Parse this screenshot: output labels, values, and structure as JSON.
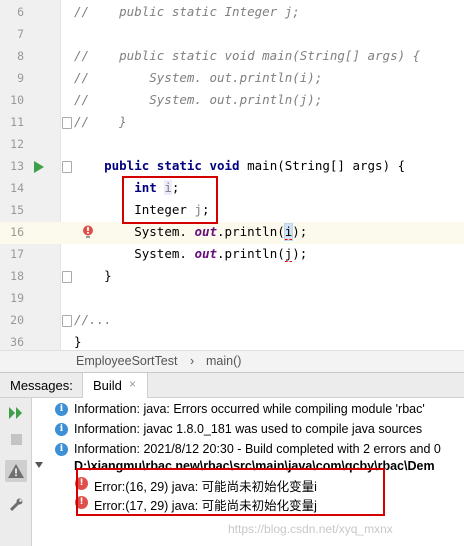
{
  "editor": {
    "lines": [
      {
        "num": "6",
        "code": "//    public static Integer j;"
      },
      {
        "num": "7",
        "code": ""
      },
      {
        "num": "8",
        "code": "//    public static void main(String[] args) {"
      },
      {
        "num": "9",
        "code": "//        System. out.println(i);"
      },
      {
        "num": "10",
        "code": "//        System. out.println(j);"
      },
      {
        "num": "11",
        "code": "//    }"
      },
      {
        "num": "12",
        "code": ""
      },
      {
        "num": "13",
        "code": "    public static void main(String[] args) {"
      },
      {
        "num": "14",
        "code": "        int i;"
      },
      {
        "num": "15",
        "code": "        Integer j;"
      },
      {
        "num": "16",
        "code": "        System. out.println(i);"
      },
      {
        "num": "17",
        "code": "        System. out.println(j);"
      },
      {
        "num": "18",
        "code": "    }"
      },
      {
        "num": "19",
        "code": ""
      },
      {
        "num": "20",
        "code": "//..."
      },
      {
        "num": "36",
        "code": "}"
      }
    ],
    "tokens": {
      "kw_public": "public",
      "kw_static": "static",
      "kw_void": "void",
      "main_sig": " main(String[] args) {",
      "kw_int": "int",
      "var_i": "i",
      "var_j": "j",
      "type_integer": "Integer",
      "system": "System. ",
      "out": "out",
      "println_open": ".println(",
      "close": ");",
      "semicolon": ";",
      "brace_close": "}"
    }
  },
  "breadcrumb": {
    "class_name": "EmployeeSortTest",
    "separator": "›",
    "method": "main()"
  },
  "tool_window": {
    "tab_messages": "Messages:",
    "tab_build": "Build",
    "tab_close": "×",
    "messages": [
      {
        "type": "info",
        "text": "Information: java: Errors occurred while compiling module 'rbac'"
      },
      {
        "type": "info",
        "text": "Information: javac 1.8.0_181 was used to compile java sources"
      },
      {
        "type": "info",
        "text": "Information: 2021/8/12 20:30 - Build completed with 2 errors and 0"
      },
      {
        "type": "path",
        "text": "D:\\xiangmu\\rbac new\\rbac\\src\\main\\java\\com\\qcby\\rbac\\Dem"
      },
      {
        "type": "error",
        "text": "Error:(16, 29)  java: 可能尚未初始化变量i"
      },
      {
        "type": "error",
        "text": "Error:(17, 29)  java: 可能尚未初始化变量j"
      }
    ],
    "watermark": "https://blog.csdn.net/xyq_mxnx"
  },
  "colors": {
    "keyword": "#000080",
    "comment": "#808080",
    "field": "#660e7a",
    "highlight_box": "#d40000",
    "run_icon": "#3fa04a",
    "info_icon": "#3d8fd6",
    "error_icon": "#e0504a"
  }
}
